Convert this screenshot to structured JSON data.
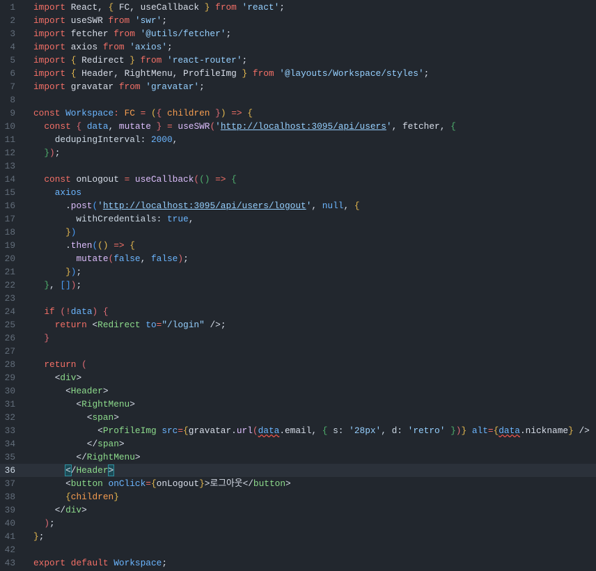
{
  "editor": {
    "current_line": 36,
    "lines": [
      [
        [
          "import",
          "k"
        ],
        [
          " React, ",
          "t"
        ],
        [
          "{",
          "b1"
        ],
        [
          " FC, useCallback ",
          "t"
        ],
        [
          "}",
          "b1"
        ],
        [
          " ",
          "t"
        ],
        [
          "from",
          "k"
        ],
        [
          " 'react'",
          "s"
        ],
        [
          ";",
          "t"
        ]
      ],
      [
        [
          "import",
          "k"
        ],
        [
          " useSWR ",
          "t"
        ],
        [
          "from",
          "k"
        ],
        [
          " 'swr'",
          "s"
        ],
        [
          ";",
          "t"
        ]
      ],
      [
        [
          "import",
          "k"
        ],
        [
          " fetcher ",
          "t"
        ],
        [
          "from",
          "k"
        ],
        [
          " '@utils/fetcher'",
          "s"
        ],
        [
          ";",
          "t"
        ]
      ],
      [
        [
          "import",
          "k"
        ],
        [
          " axios ",
          "t"
        ],
        [
          "from",
          "k"
        ],
        [
          " 'axios'",
          "s"
        ],
        [
          ";",
          "t"
        ]
      ],
      [
        [
          "import",
          "k"
        ],
        [
          " ",
          "t"
        ],
        [
          "{",
          "b1"
        ],
        [
          " Redirect ",
          "t"
        ],
        [
          "}",
          "b1"
        ],
        [
          " ",
          "t"
        ],
        [
          "from",
          "k"
        ],
        [
          " 'react-router'",
          "s"
        ],
        [
          ";",
          "t"
        ]
      ],
      [
        [
          "import",
          "k"
        ],
        [
          " ",
          "t"
        ],
        [
          "{",
          "b1"
        ],
        [
          " Header, RightMenu, ProfileImg ",
          "t"
        ],
        [
          "}",
          "b1"
        ],
        [
          " ",
          "t"
        ],
        [
          "from",
          "k"
        ],
        [
          " '@layouts/Workspace/styles'",
          "s"
        ],
        [
          ";",
          "t"
        ]
      ],
      [
        [
          "import",
          "k"
        ],
        [
          " gravatar ",
          "t"
        ],
        [
          "from",
          "k"
        ],
        [
          " 'gravatar'",
          "s"
        ],
        [
          ";",
          "t"
        ]
      ],
      [],
      [
        [
          "const",
          "k"
        ],
        [
          " ",
          "t"
        ],
        [
          "Workspace",
          "v"
        ],
        [
          ": ",
          "k"
        ],
        [
          "FC",
          "o"
        ],
        [
          " = ",
          "k"
        ],
        [
          "(",
          "b1"
        ],
        [
          "{",
          "b2"
        ],
        [
          " children ",
          "o"
        ],
        [
          "}",
          "b2"
        ],
        [
          ")",
          "b1"
        ],
        [
          " => ",
          "k"
        ],
        [
          "{",
          "b1"
        ]
      ],
      [
        [
          "  const",
          "k"
        ],
        [
          " ",
          "t"
        ],
        [
          "{",
          "b2"
        ],
        [
          " data",
          "v"
        ],
        [
          ", ",
          "t"
        ],
        [
          "mutate ",
          "f"
        ],
        [
          "}",
          "b2"
        ],
        [
          " = ",
          "k"
        ],
        [
          "useSWR",
          "f"
        ],
        [
          "(",
          "b2"
        ],
        [
          "'",
          "s"
        ],
        [
          "http://localhost:3095/api/users",
          "s u"
        ],
        [
          "'",
          "s"
        ],
        [
          ", fetcher, ",
          "t"
        ],
        [
          "{",
          "b3"
        ]
      ],
      [
        [
          "    dedupingInterval: ",
          "pr"
        ],
        [
          "2000",
          "n"
        ],
        [
          ",",
          "t"
        ]
      ],
      [
        [
          "  ",
          "t"
        ],
        [
          "}",
          "b3"
        ],
        [
          ")",
          "b2"
        ],
        [
          ";",
          "t"
        ]
      ],
      [],
      [
        [
          "  const",
          "k"
        ],
        [
          " onLogout ",
          "t"
        ],
        [
          "= ",
          "k"
        ],
        [
          "useCallback",
          "f"
        ],
        [
          "(",
          "b2"
        ],
        [
          "()",
          "b3"
        ],
        [
          " => ",
          "k"
        ],
        [
          "{",
          "b3"
        ]
      ],
      [
        [
          "    axios",
          "v"
        ]
      ],
      [
        [
          "      .",
          "t"
        ],
        [
          "post",
          "f"
        ],
        [
          "(",
          "b4"
        ],
        [
          "'",
          "s"
        ],
        [
          "http://localhost:3095/api/users/logout",
          "s u"
        ],
        [
          "'",
          "s"
        ],
        [
          ", ",
          "t"
        ],
        [
          "null",
          "n"
        ],
        [
          ", ",
          "t"
        ],
        [
          "{",
          "b1"
        ]
      ],
      [
        [
          "        withCredentials: ",
          "pr"
        ],
        [
          "true",
          "n"
        ],
        [
          ",",
          "t"
        ]
      ],
      [
        [
          "      ",
          "t"
        ],
        [
          "}",
          "b1"
        ],
        [
          ")",
          "b4"
        ]
      ],
      [
        [
          "      .",
          "t"
        ],
        [
          "then",
          "f"
        ],
        [
          "(",
          "b4"
        ],
        [
          "()",
          "b1"
        ],
        [
          " => ",
          "k"
        ],
        [
          "{",
          "b1"
        ]
      ],
      [
        [
          "        ",
          "t"
        ],
        [
          "mutate",
          "f"
        ],
        [
          "(",
          "b2"
        ],
        [
          "false",
          "n"
        ],
        [
          ", ",
          "t"
        ],
        [
          "false",
          "n"
        ],
        [
          ")",
          "b2"
        ],
        [
          ";",
          "t"
        ]
      ],
      [
        [
          "      ",
          "t"
        ],
        [
          "}",
          "b1"
        ],
        [
          ")",
          "b4"
        ],
        [
          ";",
          "t"
        ]
      ],
      [
        [
          "  ",
          "t"
        ],
        [
          "}",
          "b3"
        ],
        [
          ", ",
          "t"
        ],
        [
          "[]",
          "b4"
        ],
        [
          ")",
          "b2"
        ],
        [
          ";",
          "t"
        ]
      ],
      [],
      [
        [
          "  if",
          "k"
        ],
        [
          " ",
          "t"
        ],
        [
          "(",
          "b2"
        ],
        [
          "!",
          "k"
        ],
        [
          "data",
          "v"
        ],
        [
          ")",
          "b2"
        ],
        [
          " ",
          "t"
        ],
        [
          "{",
          "b2"
        ]
      ],
      [
        [
          "    return",
          "k"
        ],
        [
          " <",
          "t"
        ],
        [
          "Redirect",
          "g"
        ],
        [
          " to",
          "a"
        ],
        [
          "=",
          "k"
        ],
        [
          "\"/login\"",
          "s"
        ],
        [
          " />",
          "t"
        ],
        [
          ";",
          "t"
        ]
      ],
      [
        [
          "  ",
          "t"
        ],
        [
          "}",
          "b2"
        ]
      ],
      [],
      [
        [
          "  return",
          "k"
        ],
        [
          " ",
          "t"
        ],
        [
          "(",
          "b2"
        ]
      ],
      [
        [
          "    <",
          "t"
        ],
        [
          "div",
          "g"
        ],
        [
          ">",
          "t"
        ]
      ],
      [
        [
          "      <",
          "t"
        ],
        [
          "Header",
          "g"
        ],
        [
          ">",
          "t"
        ]
      ],
      [
        [
          "        <",
          "t"
        ],
        [
          "RightMenu",
          "g"
        ],
        [
          ">",
          "t"
        ]
      ],
      [
        [
          "          <",
          "t"
        ],
        [
          "span",
          "g"
        ],
        [
          ">",
          "t"
        ]
      ],
      [
        [
          "            <",
          "t"
        ],
        [
          "ProfileImg",
          "g"
        ],
        [
          " src",
          "a"
        ],
        [
          "=",
          "k"
        ],
        [
          "{",
          "b1"
        ],
        [
          "gravatar.",
          "t"
        ],
        [
          "url",
          "f"
        ],
        [
          "(",
          "b2"
        ],
        [
          "data",
          "v w"
        ],
        [
          ".email, ",
          "t"
        ],
        [
          "{",
          "b3"
        ],
        [
          " s: ",
          "pr"
        ],
        [
          "'28px'",
          "s"
        ],
        [
          ", d: ",
          "pr"
        ],
        [
          "'retro'",
          "s"
        ],
        [
          " ",
          "t"
        ],
        [
          "}",
          "b3"
        ],
        [
          ")",
          "b2"
        ],
        [
          "}",
          "b1"
        ],
        [
          " alt",
          "a"
        ],
        [
          "=",
          "k"
        ],
        [
          "{",
          "b1"
        ],
        [
          "data",
          "v w"
        ],
        [
          ".nickname",
          "t"
        ],
        [
          "}",
          "b1"
        ],
        [
          " />",
          "t"
        ]
      ],
      [
        [
          "          </",
          "t"
        ],
        [
          "span",
          "g"
        ],
        [
          ">",
          "t"
        ]
      ],
      [
        [
          "        </",
          "t"
        ],
        [
          "RightMenu",
          "g"
        ],
        [
          ">",
          "t"
        ]
      ],
      [
        [
          "      ",
          "t"
        ],
        [
          "<",
          "t m"
        ],
        [
          "/",
          "t"
        ],
        [
          "Header",
          "g"
        ],
        [
          ">",
          "t m"
        ]
      ],
      [
        [
          "      <",
          "t"
        ],
        [
          "button",
          "g"
        ],
        [
          " onClick",
          "a"
        ],
        [
          "=",
          "k"
        ],
        [
          "{",
          "b1"
        ],
        [
          "onLogout",
          "t"
        ],
        [
          "}",
          "b1"
        ],
        [
          ">",
          "t"
        ],
        [
          "로그아웃",
          "t"
        ],
        [
          "</",
          "t"
        ],
        [
          "button",
          "g"
        ],
        [
          ">",
          "t"
        ]
      ],
      [
        [
          "      ",
          "t"
        ],
        [
          "{",
          "b1"
        ],
        [
          "children",
          "o"
        ],
        [
          "}",
          "b1"
        ]
      ],
      [
        [
          "    </",
          "t"
        ],
        [
          "div",
          "g"
        ],
        [
          ">",
          "t"
        ]
      ],
      [
        [
          "  ",
          "t"
        ],
        [
          ")",
          "b2"
        ],
        [
          ";",
          "t"
        ]
      ],
      [
        [
          "}",
          "b1"
        ],
        [
          ";",
          "t"
        ]
      ],
      [],
      [
        [
          "export",
          "k"
        ],
        [
          " ",
          "t"
        ],
        [
          "default",
          "k"
        ],
        [
          " Workspace",
          "v"
        ],
        [
          ";",
          "t"
        ]
      ]
    ]
  }
}
